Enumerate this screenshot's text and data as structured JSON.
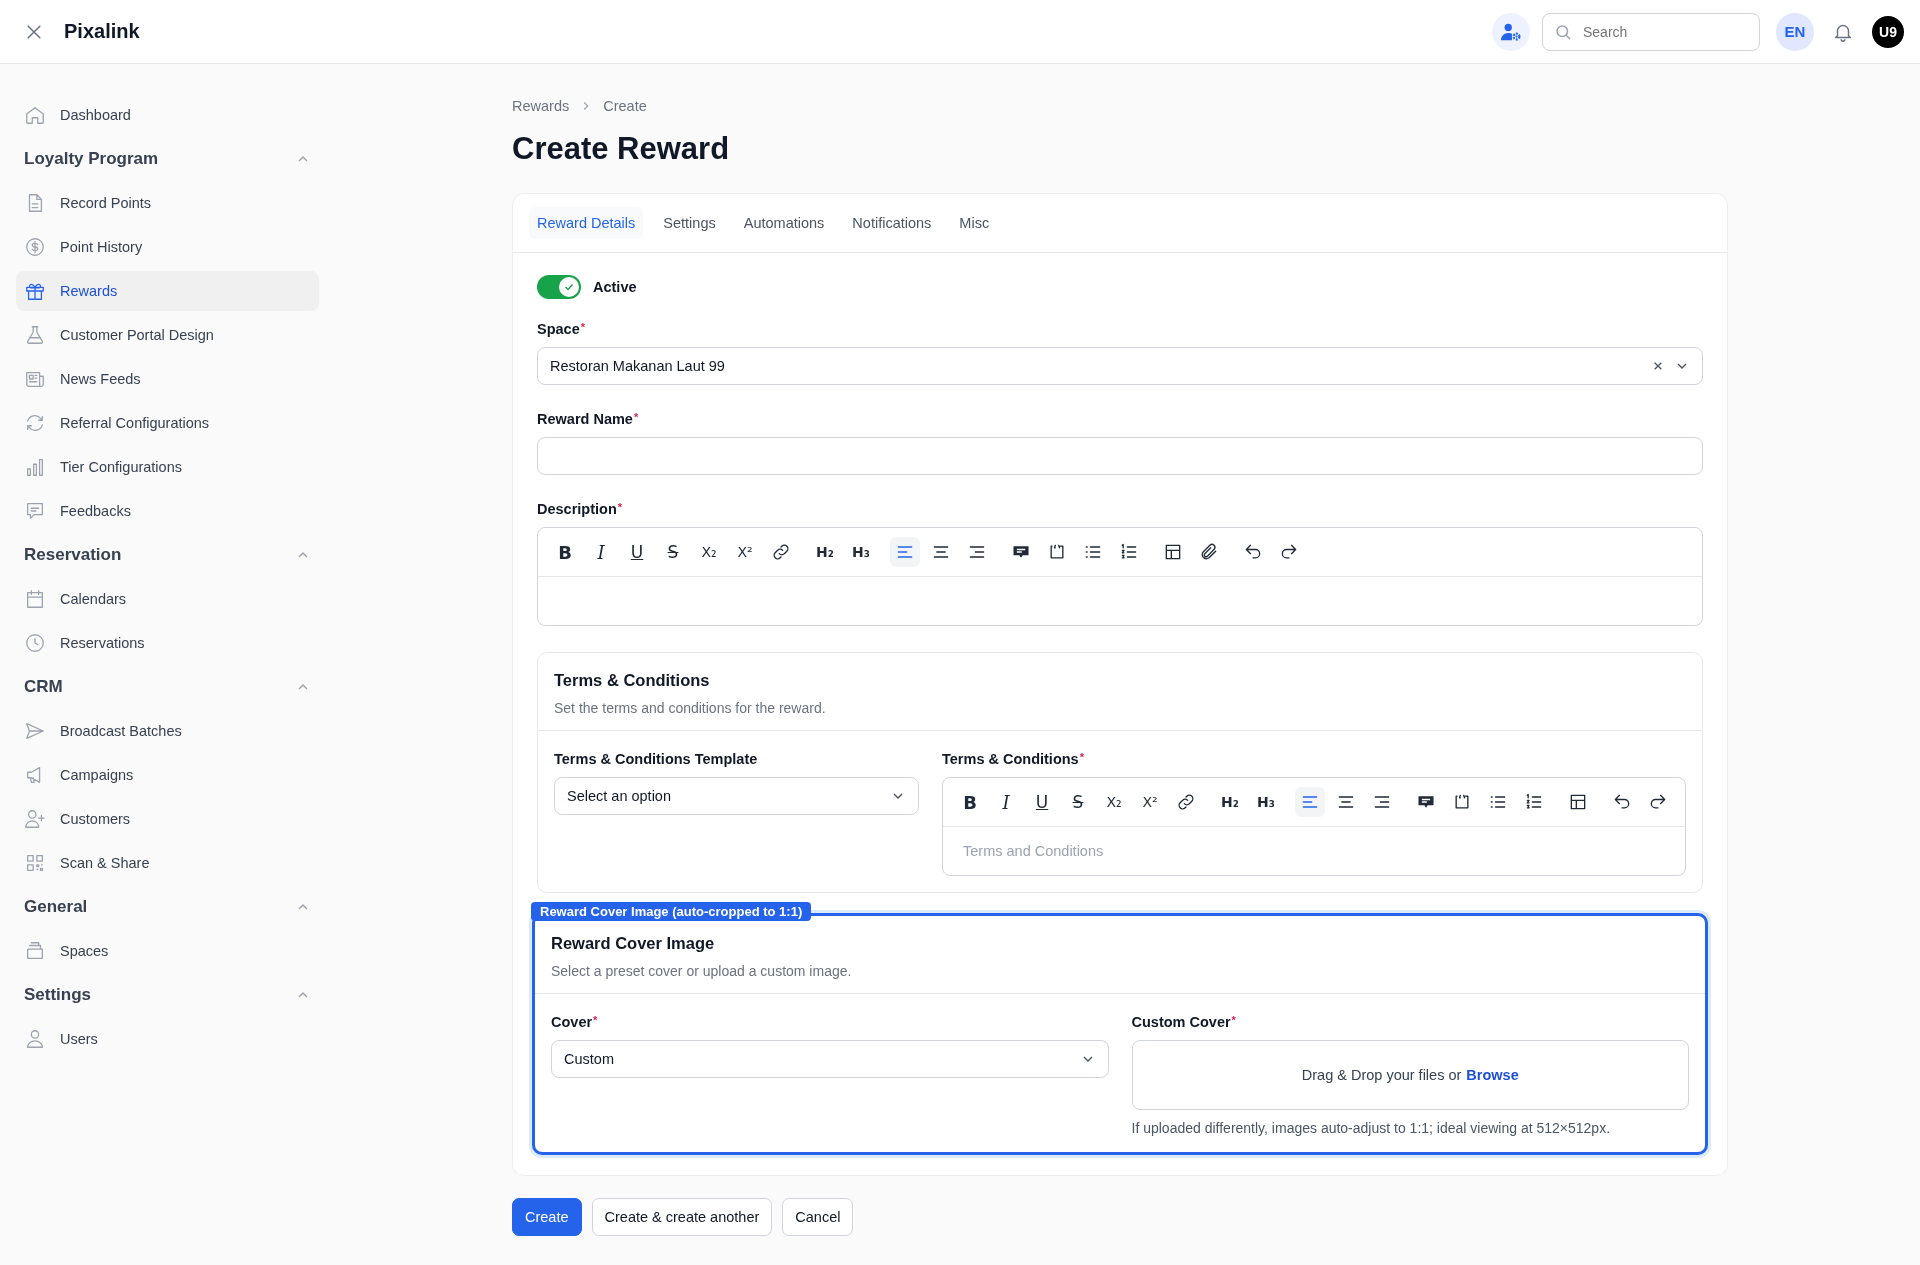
{
  "app": {
    "title": "Pixalink"
  },
  "topbar": {
    "search": {
      "placeholder": "Search"
    },
    "language": "EN",
    "avatar": "U9"
  },
  "sidebar": {
    "top": [
      {
        "label": "Dashboard",
        "selected": false
      }
    ],
    "sections": [
      {
        "title": "Loyalty Program",
        "expanded": true,
        "items": [
          {
            "label": "Record Points",
            "selected": false
          },
          {
            "label": "Point History",
            "selected": false
          },
          {
            "label": "Rewards",
            "selected": true
          },
          {
            "label": "Customer Portal Design",
            "selected": false
          },
          {
            "label": "News Feeds",
            "selected": false
          },
          {
            "label": "Referral Configurations",
            "selected": false
          },
          {
            "label": "Tier Configurations",
            "selected": false
          },
          {
            "label": "Feedbacks",
            "selected": false
          }
        ]
      },
      {
        "title": "Reservation",
        "expanded": true,
        "items": [
          {
            "label": "Calendars",
            "selected": false
          },
          {
            "label": "Reservations",
            "selected": false
          }
        ]
      },
      {
        "title": "CRM",
        "expanded": true,
        "items": [
          {
            "label": "Broadcast Batches",
            "selected": false
          },
          {
            "label": "Campaigns",
            "selected": false
          },
          {
            "label": "Customers",
            "selected": false
          },
          {
            "label": "Scan & Share",
            "selected": false
          }
        ]
      },
      {
        "title": "General",
        "expanded": true,
        "items": [
          {
            "label": "Spaces",
            "selected": false
          }
        ]
      },
      {
        "title": "Settings",
        "expanded": true,
        "items": [
          {
            "label": "Users",
            "selected": false
          }
        ]
      }
    ]
  },
  "breadcrumb": [
    "Rewards",
    "Create"
  ],
  "page_title": "Create Reward",
  "tabs": [
    {
      "label": "Reward Details",
      "selected": true
    },
    {
      "label": "Settings",
      "selected": false
    },
    {
      "label": "Automations",
      "selected": false
    },
    {
      "label": "Notifications",
      "selected": false
    },
    {
      "label": "Misc",
      "selected": false
    }
  ],
  "active_toggle": {
    "label": "Active",
    "on": true
  },
  "space": {
    "label": "Space",
    "asterisk": "*",
    "value": "Restoran Makanan Laut 99"
  },
  "reward_name": {
    "label": "Reward Name",
    "asterisk": "*"
  },
  "description": {
    "label": "Description",
    "asterisk": "*",
    "toolbar": [
      {
        "kind": "bold",
        "glyph": "B",
        "selected": false
      },
      {
        "kind": "italic",
        "glyph": "I",
        "selected": false
      },
      {
        "kind": "underline",
        "glyph": "U",
        "selected": false
      },
      {
        "kind": "strike",
        "glyph": "S",
        "selected": false
      },
      {
        "kind": "sub",
        "glyph": "X₂",
        "selected": false
      },
      {
        "kind": "sup",
        "glyph": "X²",
        "selected": false
      },
      {
        "kind": "link",
        "selected": false
      },
      {
        "kind": "h2",
        "glyph": "H₂",
        "selected": false
      },
      {
        "kind": "h3",
        "glyph": "H₃",
        "selected": false
      },
      {
        "kind": "align-left",
        "selected": true
      },
      {
        "kind": "align-center",
        "selected": false
      },
      {
        "kind": "align-right",
        "selected": false
      },
      {
        "kind": "comment",
        "selected": false
      },
      {
        "kind": "code",
        "selected": false
      },
      {
        "kind": "bullets",
        "selected": false
      },
      {
        "kind": "numbers",
        "selected": false
      },
      {
        "kind": "table",
        "selected": false
      },
      {
        "kind": "attach",
        "selected": false
      },
      {
        "kind": "undo",
        "selected": false
      },
      {
        "kind": "redo",
        "selected": false
      }
    ]
  },
  "terms": {
    "title": "Terms & Conditions",
    "subtitle": "Set the terms and conditions for the reward.",
    "template": {
      "label": "Terms & Conditions Template",
      "placeholder": "Select an option"
    },
    "editor": {
      "label": "Terms & Conditions",
      "asterisk": "*",
      "placeholder": "Terms and Conditions",
      "toolbar": [
        {
          "kind": "bold",
          "glyph": "B",
          "selected": false
        },
        {
          "kind": "italic",
          "glyph": "I",
          "selected": false
        },
        {
          "kind": "underline",
          "glyph": "U",
          "selected": false
        },
        {
          "kind": "strike",
          "glyph": "S",
          "selected": false
        },
        {
          "kind": "sub",
          "glyph": "X₂",
          "selected": false
        },
        {
          "kind": "sup",
          "glyph": "X²",
          "selected": false
        },
        {
          "kind": "link",
          "selected": false
        },
        {
          "kind": "h2",
          "glyph": "H₂",
          "selected": false
        },
        {
          "kind": "h3",
          "glyph": "H₃",
          "selected": false
        },
        {
          "kind": "align-left",
          "selected": true
        },
        {
          "kind": "align-center",
          "selected": false
        },
        {
          "kind": "align-right",
          "selected": false
        },
        {
          "kind": "comment",
          "selected": false
        },
        {
          "kind": "code",
          "selected": false
        },
        {
          "kind": "bullets",
          "selected": false
        },
        {
          "kind": "numbers",
          "selected": false
        },
        {
          "kind": "table",
          "selected": false
        },
        {
          "kind": "undo",
          "selected": false
        },
        {
          "kind": "redo",
          "selected": false
        }
      ]
    }
  },
  "cover": {
    "badge": "Reward Cover Image (auto-cropped to 1:1)",
    "highlighted": true,
    "title": "Reward Cover Image",
    "subtitle": "Select a preset cover or upload a custom image.",
    "select": {
      "label": "Cover",
      "asterisk": "*",
      "value": "Custom"
    },
    "upload": {
      "label": "Custom Cover",
      "asterisk": "*",
      "text": "Drag & Drop your files or",
      "link": "Browse",
      "hint": "If uploaded differently, images auto-adjust to 1:1; ideal viewing at 512×512px."
    }
  },
  "buttons": [
    {
      "label": "Create",
      "kind": "primary"
    },
    {
      "label": "Create & create another",
      "kind": "secondary"
    },
    {
      "label": "Cancel",
      "kind": "secondary"
    }
  ]
}
